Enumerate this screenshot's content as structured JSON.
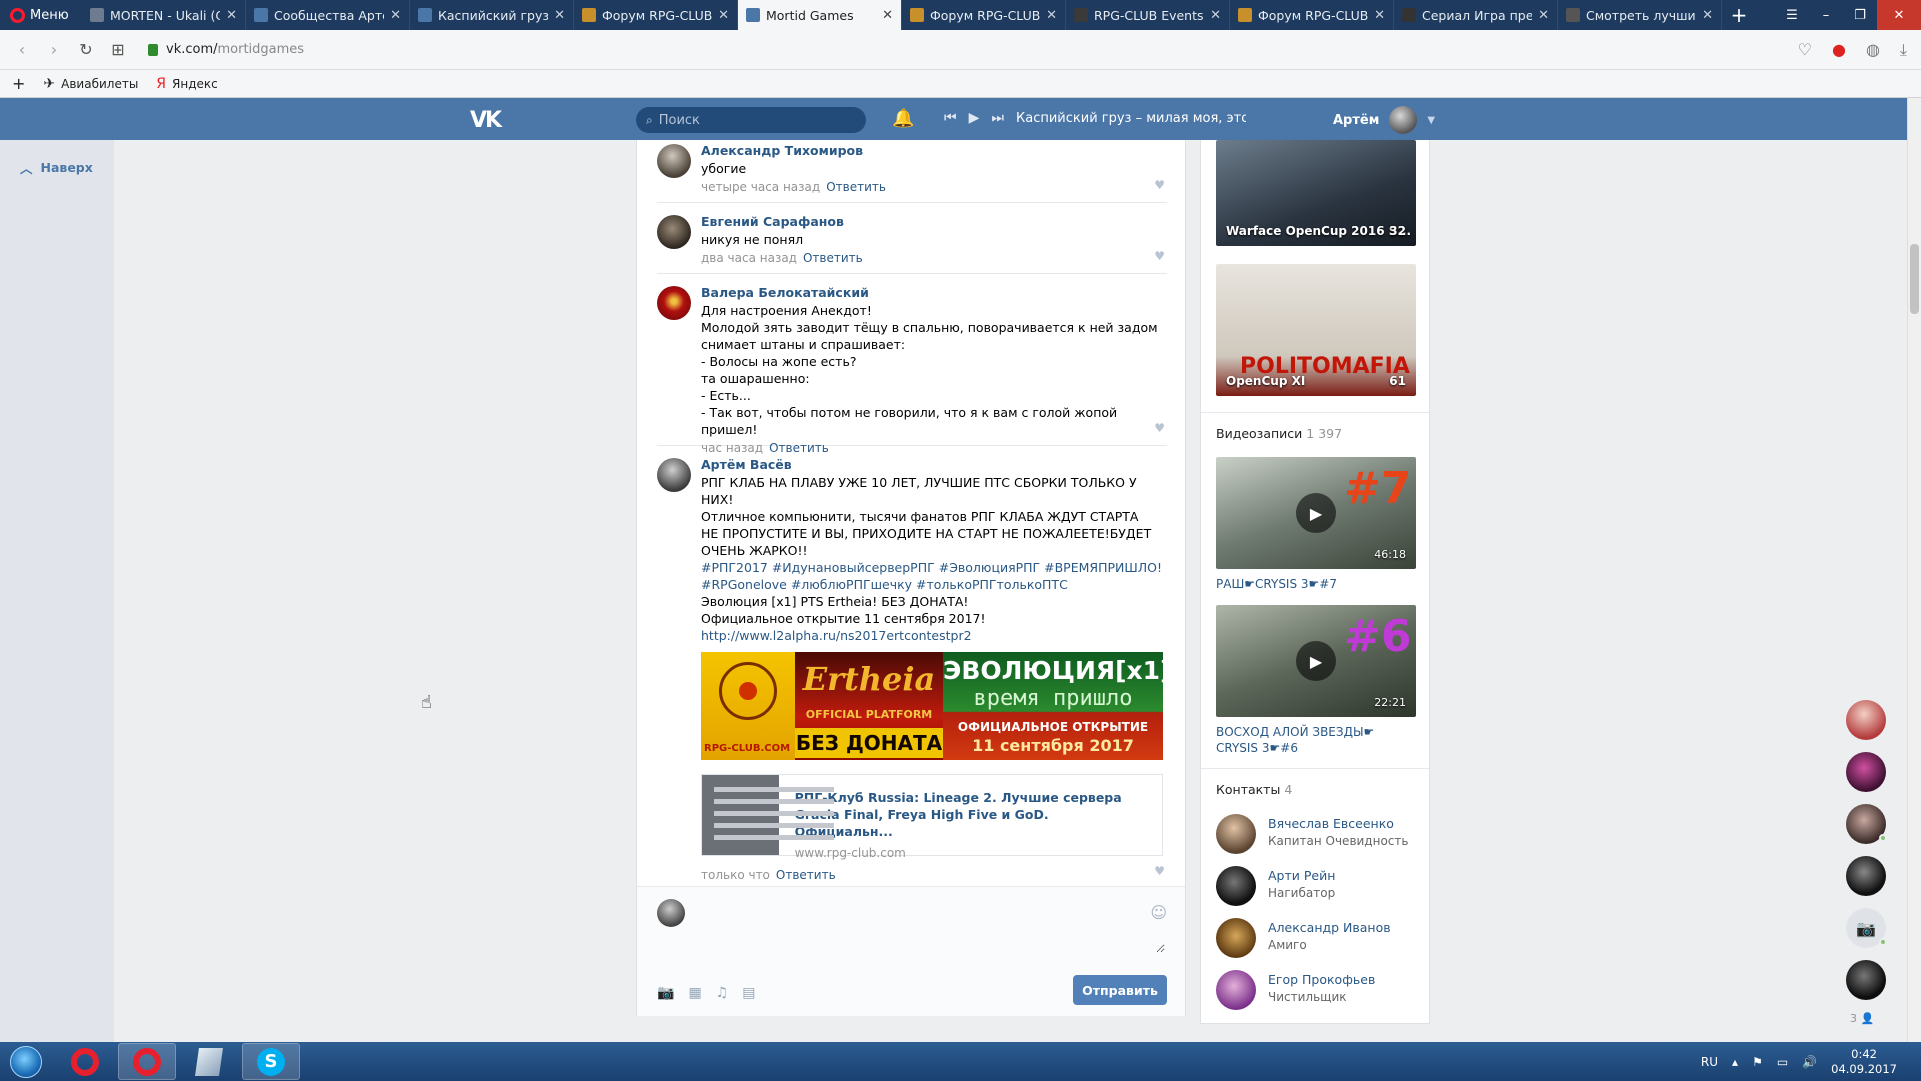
{
  "browser": {
    "menu_label": "Меню",
    "tabs": [
      {
        "title": "MORTEN - Ukali (Or",
        "color": "#6f7c8f"
      },
      {
        "title": "Сообщества Артём",
        "color": "#4a76a8"
      },
      {
        "title": "Каспийский груз - м",
        "color": "#4a76a8"
      },
      {
        "title": "Форум RPG-CLUB. Т",
        "color": "#c8902a"
      },
      {
        "title": "Mortid Games",
        "color": "#4a76a8"
      },
      {
        "title": "Форум RPG-CLUB. Т",
        "color": "#c8902a"
      },
      {
        "title": "RPG-CLUB Events Sc",
        "color": "#3a3a3a"
      },
      {
        "title": "Форум RPG-CLUB. Т",
        "color": "#c8902a"
      },
      {
        "title": "Сериал Игра прест",
        "color": "#333333"
      },
      {
        "title": "Смотреть лучшие с",
        "color": "#555555"
      }
    ],
    "active_tab_index": 4,
    "url_host": "vk.com/",
    "url_path": "mortidgames",
    "bookmarks": [
      {
        "label": "Авиабилеты",
        "icon": "plane-icon"
      },
      {
        "label": "Яндекс",
        "icon": "yandex-icon"
      }
    ]
  },
  "header": {
    "search_placeholder": "Поиск",
    "now_playing": "Каспийский груз – милая моя, это...",
    "user_name": "Артём"
  },
  "left": {
    "to_top_label": "Наверх"
  },
  "comments": [
    {
      "author": "Александр Тихомиров",
      "text": "убогие",
      "time": "четыре часа назад",
      "reply": "Ответить"
    },
    {
      "author": "Евгений Сарафанов",
      "text": "никуя не понял",
      "time": "два часа назад",
      "reply": "Ответить"
    },
    {
      "author": "Валера Белокатайский",
      "text": "Для настроения Анекдот!\nМолодой зять заводит тёщу в спальню, поворачивается к ней задом снимает штаны и спрашивает:\n- Волосы на жопе есть?\nта ошарашенно:\n- Есть...\n- Так вот, чтобы потом не говорили, что я к вам с голой жопой пришел!",
      "time": "час назад",
      "reply": "Ответить"
    },
    {
      "author": "Артём Васёв",
      "text": "РПГ КЛАБ НА ПЛАВУ УЖЕ 10 ЛЕТ, ЛУЧШИЕ ПТС СБОРКИ ТОЛЬКО У НИХ!\nОтличное компьюнити, тысячи фанатов РПГ КЛАБА ЖДУТ СТАРТА\nНЕ ПРОПУСТИТЕ И ВЫ, ПРИХОДИТЕ НА СТАРТ НЕ ПОЖАЛЕЕТЕ!БУДЕТ ОЧЕНЬ ЖАРКО!!",
      "tags": "#РПГ2017 #ИдунановыйсерверРПГ #ЭволюцияРПГ #ВРЕМЯПРИШЛО! #RPGonelove #люблюРПГшечку #толькоРПГтолькоПТС",
      "text2": "Эволюция [x1] PTS Ertheia! БЕЗ ДОНАТА!\nОфициальное открытие 11 сентября 2017!",
      "link": "http://www.l2alpha.ru/ns2017ertcontestpr2",
      "banner": {
        "site": "RPG-CLUB.COM",
        "logo": "Ertheia",
        "platform": "OFFICIAL PLATFORM",
        "no_donate": "БЕЗ ДОНАТА",
        "evo": "ЭВОЛЮЦИЯ[x1]",
        "time_came": "время пришло",
        "opening": "ОФИЦИАЛЬНОЕ ОТКРЫТИЕ",
        "date": "11 сентября 2017"
      },
      "snippet_title": "РПГ-Клуб Russia: Lineage 2. Лучшие сервера Gracia Final, Freya High Five и GoD. Официальн...",
      "snippet_host": "www.rpg-club.com",
      "time": "только что",
      "reply": "Ответить"
    }
  ],
  "composer": {
    "send_label": "Отправить"
  },
  "sidebar": {
    "albums": [
      {
        "caption": "Warface OpenCup 2016 S...",
        "count": "32"
      },
      {
        "caption": "OpenCup XI",
        "count": "61",
        "art": "POLITOMAFIA"
      }
    ],
    "videos_title": "Видеозаписи",
    "videos_count": "1 397",
    "videos": [
      {
        "title": "РАШ☛CRYSIS 3☛#7",
        "duration": "46:18",
        "badge": "#7",
        "badge_color": "#e8441a"
      },
      {
        "title": "ВОСХОД АЛОЙ ЗВЕЗДЫ☛CRYSIS 3☛#6",
        "duration": "22:21",
        "badge": "#6",
        "badge_color": "#c03bd6"
      }
    ],
    "contacts_title": "Контакты",
    "contacts_count": "4",
    "contacts": [
      {
        "name": "Вячеслав Евсеенко",
        "role": "Капитан Очевидность"
      },
      {
        "name": "Арти Рейн",
        "role": "Нагибатор"
      },
      {
        "name": "Александр Иванов",
        "role": "Амиго"
      },
      {
        "name": "Егор Прокофьев",
        "role": "Чистильщик"
      }
    ]
  },
  "chatbar": {
    "online_count": "3"
  },
  "taskbar": {
    "lang": "RU",
    "time": "0:42",
    "date": "04.09.2017"
  },
  "colors": {
    "vk_blue": "#4a76a8",
    "link": "#2a5885",
    "send_button": "#5181b8"
  }
}
